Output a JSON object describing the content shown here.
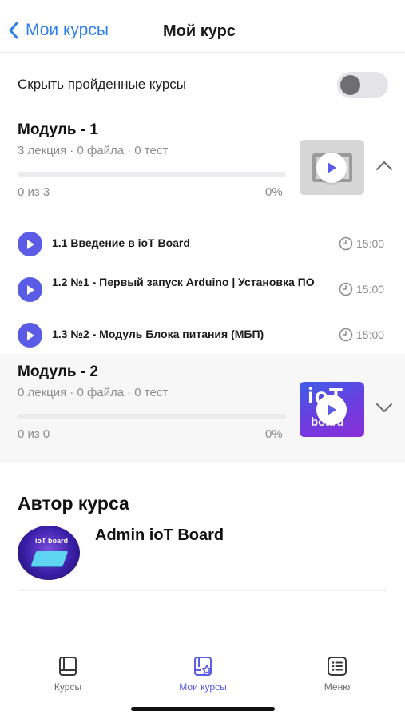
{
  "header": {
    "back_label": "Мои курсы",
    "title": "Мой курс"
  },
  "filter": {
    "hide_completed_label": "Скрыть пройденные курсы",
    "hide_completed_on": false
  },
  "modules": [
    {
      "title": "Модуль - 1",
      "lectures": "3 лекция",
      "files": "0 файла",
      "tests": "0 тест",
      "progress_count": "0 из 3",
      "progress_pct": "0%",
      "progress_value": 0,
      "thumbnail": "grey-screen-play",
      "expanded": true,
      "chevron_icon": "chevron-up-icon"
    },
    {
      "title": "Модуль - 2",
      "lectures": "0 лекция",
      "files": "0 файла",
      "tests": "0 тест",
      "progress_count": "0 из 0",
      "progress_pct": "0%",
      "progress_value": 0,
      "thumbnail": "iot-board-play",
      "thumb_text_1": "iоT",
      "thumb_text_2": "board",
      "expanded": false,
      "chevron_icon": "chevron-down-icon"
    }
  ],
  "lessons": [
    {
      "title": "1.1 Введение в ioT Board",
      "time": "15:00"
    },
    {
      "title": "1.2 №1 - Первый запуск Arduino | Установка ПО",
      "time": "15:00"
    },
    {
      "title": "1.3 №2 - Модуль Блока питания (МБП)",
      "time": "15:00"
    }
  ],
  "author": {
    "heading": "Автор курса",
    "name": "Admin ioT Board",
    "avatar_text": "iоT board"
  },
  "tabbar": {
    "tabs": [
      {
        "label": "Курсы",
        "icon": "book-icon",
        "active": false
      },
      {
        "label": "Мои курсы",
        "icon": "my-courses-icon",
        "active": true
      },
      {
        "label": "Меню",
        "icon": "menu-list-icon",
        "active": false
      }
    ]
  },
  "colors": {
    "accent": "#5a5ce6",
    "link": "#2f80ed",
    "muted": "#8c8c8c"
  }
}
